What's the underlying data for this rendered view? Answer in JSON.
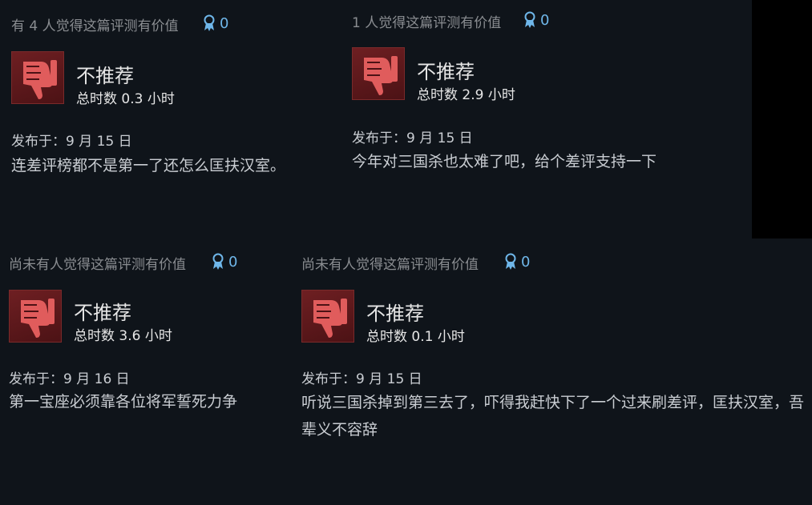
{
  "colors": {
    "background": "#0f141a",
    "thumb_down": "#e05c5c",
    "award": "#6fb7ea"
  },
  "icons": {
    "award": "award-ribbon-icon",
    "verdict": "thumbs-down-icon"
  },
  "reviews": [
    {
      "helpful": "有 4 人觉得这篇评测有价值",
      "award_count": "0",
      "verdict": "不推荐",
      "hours": "总时数 0.3 小时",
      "posted": "发布于：9 月 15 日",
      "text": "连差评榜都不是第一了还怎么匡扶汉室。"
    },
    {
      "helpful": "1 人觉得这篇评测有价值",
      "award_count": "0",
      "verdict": "不推荐",
      "hours": "总时数 2.9 小时",
      "posted": "发布于：9 月 15 日",
      "text": "今年对三国杀也太难了吧，给个差评支持一下"
    },
    {
      "helpful": "尚未有人觉得这篇评测有价值",
      "award_count": "0",
      "verdict": "不推荐",
      "hours": "总时数 3.6 小时",
      "posted": "发布于：9 月 16 日",
      "text": "第一宝座必须靠各位将军誓死力争"
    },
    {
      "helpful": "尚未有人觉得这篇评测有价值",
      "award_count": "0",
      "verdict": "不推荐",
      "hours": "总时数 0.1 小时",
      "posted": "发布于：9 月 15 日",
      "text": "听说三国杀掉到第三去了，吓得我赶快下了一个过来刷差评，匡扶汉室，吾辈义不容辞"
    }
  ]
}
